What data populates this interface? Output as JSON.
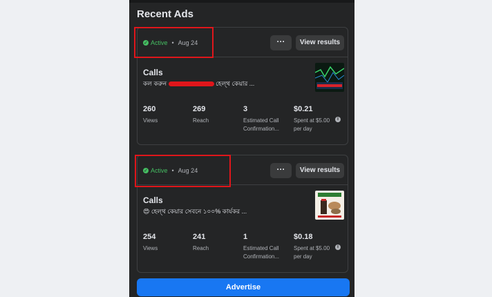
{
  "panel": {
    "title": "Recent Ads"
  },
  "ads": [
    {
      "status": "Active",
      "date": "Aug 24",
      "more_label": "···",
      "view_label": "View results",
      "title": "Calls",
      "text_prefix": "কল করুন ",
      "text_suffix": " হেল্থ কেয়ার ...",
      "stats": [
        {
          "value": "260",
          "label": "Views"
        },
        {
          "value": "269",
          "label": "Reach"
        },
        {
          "value": "3",
          "label": "Estimated Call Confirmation..."
        },
        {
          "value": "$0.21",
          "label": "Spent at $5.00 per day"
        }
      ]
    },
    {
      "status": "Active",
      "date": "Aug 24",
      "more_label": "···",
      "view_label": "View results",
      "title": "Calls",
      "text_prefix": "😍",
      "text_suffix": " হেল্থ কেয়ার সেবনে ১০০% কার্যকর ...",
      "stats": [
        {
          "value": "254",
          "label": "Views"
        },
        {
          "value": "241",
          "label": "Reach"
        },
        {
          "value": "1",
          "label": "Estimated Call Confirmation..."
        },
        {
          "value": "$0.18",
          "label": "Spent at $5.00 per day"
        }
      ]
    }
  ],
  "advertise_label": "Advertise",
  "colors": {
    "panel_bg": "#242526",
    "active_green": "#45bd62",
    "accent_blue": "#1877f2",
    "annotation_red": "#e0161b"
  }
}
